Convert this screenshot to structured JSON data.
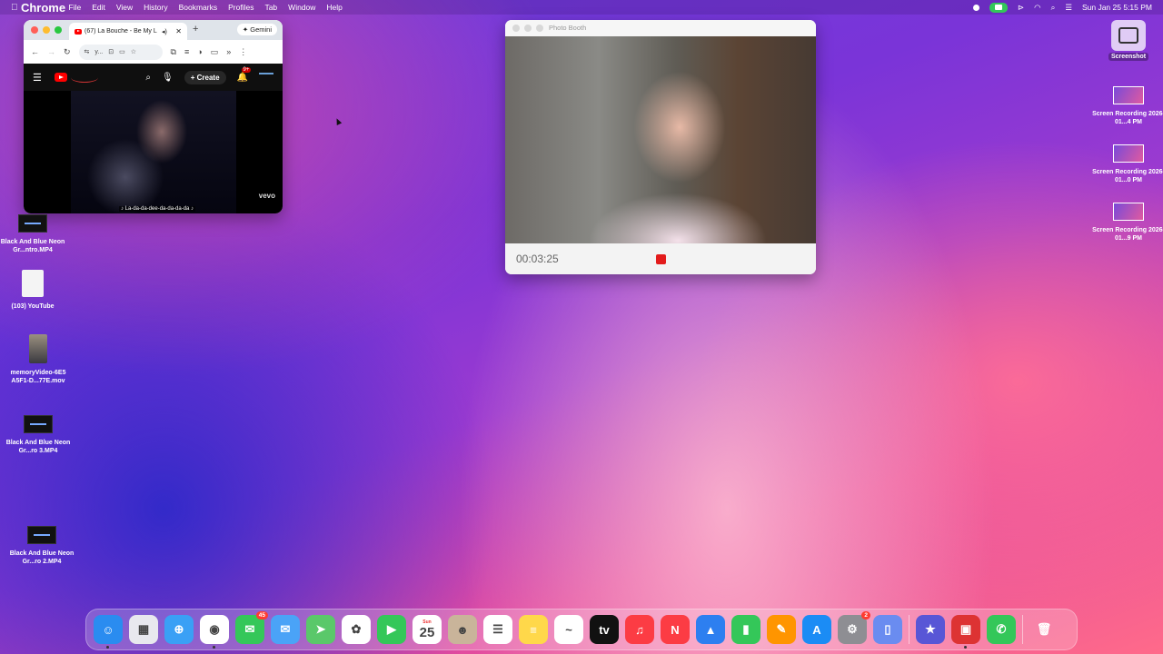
{
  "menubar": {
    "app": "Chrome",
    "items": [
      "File",
      "Edit",
      "View",
      "History",
      "Bookmarks",
      "Profiles",
      "Tab",
      "Window",
      "Help"
    ],
    "clock": "Sun Jan 25  5:15 PM"
  },
  "chrome": {
    "tab_title": "(67) La Bouche - Be My L",
    "new_tab": "+",
    "gemini": "Gemini",
    "omnibox": "y...",
    "youtube": {
      "create_label": "Create",
      "notifications_badge": "9+",
      "caption": "♪ La-da-da-dee-da-da-da-da ♪",
      "watermark": "vevo"
    }
  },
  "photobooth": {
    "title": "Photo Booth",
    "timer": "00:03:25"
  },
  "desktop_left": [
    {
      "label": "Black And Blue Neon Gr...ntro.MP4",
      "kind": "video"
    },
    {
      "label": "(103) YouTube",
      "kind": "doc"
    },
    {
      "label": "memoryVideo-6E5 A5F1-D...77E.mov",
      "kind": "mov"
    },
    {
      "label": "Black And Blue Neon Gr...ro 3.MP4",
      "kind": "video"
    },
    {
      "label": "Black And Blue Neon Gr...ro 2.MP4",
      "kind": "video"
    }
  ],
  "desktop_right": [
    {
      "label": "Screenshot",
      "kind": "shot"
    },
    {
      "label": "Screen Recording 2026-01...4 PM",
      "kind": "rec"
    },
    {
      "label": "Screen Recording 2026-01...0 PM",
      "kind": "rec"
    },
    {
      "label": "Screen Recording 2026-01...9 PM",
      "kind": "rec"
    }
  ],
  "dock": [
    {
      "name": "finder",
      "color": "#2a8cf0",
      "glyph": "☺",
      "running": true
    },
    {
      "name": "launchpad",
      "color": "#e8e8ee",
      "glyph": "▦"
    },
    {
      "name": "safari",
      "color": "#3aa0f5",
      "glyph": "⊕"
    },
    {
      "name": "chrome",
      "color": "#fff",
      "glyph": "◉",
      "running": true
    },
    {
      "name": "messages",
      "color": "#34c759",
      "glyph": "✉",
      "badge": "45"
    },
    {
      "name": "mail",
      "color": "#4aa3f7",
      "glyph": "✉"
    },
    {
      "name": "maps",
      "color": "#5ac86a",
      "glyph": "➤"
    },
    {
      "name": "photos",
      "color": "#fff",
      "glyph": "✿"
    },
    {
      "name": "facetime",
      "color": "#34c759",
      "glyph": "▶"
    },
    {
      "name": "calendar",
      "color": "#fff",
      "glyph": "25",
      "month": "Sun"
    },
    {
      "name": "contacts",
      "color": "#c9b49a",
      "glyph": "☻"
    },
    {
      "name": "reminders",
      "color": "#fff",
      "glyph": "☰"
    },
    {
      "name": "notes",
      "color": "#ffd84a",
      "glyph": "≡"
    },
    {
      "name": "freeform",
      "color": "#fff",
      "glyph": "~"
    },
    {
      "name": "apple-tv",
      "color": "#111",
      "glyph": "tv"
    },
    {
      "name": "music",
      "color": "#fc3c44",
      "glyph": "♫"
    },
    {
      "name": "news",
      "color": "#fc3c44",
      "glyph": "N"
    },
    {
      "name": "keynote",
      "color": "#2d7ff0",
      "glyph": "▲"
    },
    {
      "name": "numbers",
      "color": "#34c759",
      "glyph": "▮"
    },
    {
      "name": "pages",
      "color": "#ff9500",
      "glyph": "✎"
    },
    {
      "name": "app-store",
      "color": "#1b8cf5",
      "glyph": "A"
    },
    {
      "name": "system-settings",
      "color": "#8e8e93",
      "glyph": "⚙",
      "badge": "2"
    },
    {
      "name": "iphone-mirroring",
      "color": "#6a8cf0",
      "glyph": "▯"
    },
    {
      "name": "sep",
      "color": "",
      "glyph": ""
    },
    {
      "name": "imovie",
      "color": "#5856d6",
      "glyph": "★"
    },
    {
      "name": "photo-booth",
      "color": "#d33",
      "glyph": "▣",
      "running": true
    },
    {
      "name": "phone",
      "color": "#34c759",
      "glyph": "✆"
    },
    {
      "name": "sep",
      "color": "",
      "glyph": ""
    },
    {
      "name": "trash",
      "color": "transparent",
      "glyph": "🗑"
    }
  ]
}
